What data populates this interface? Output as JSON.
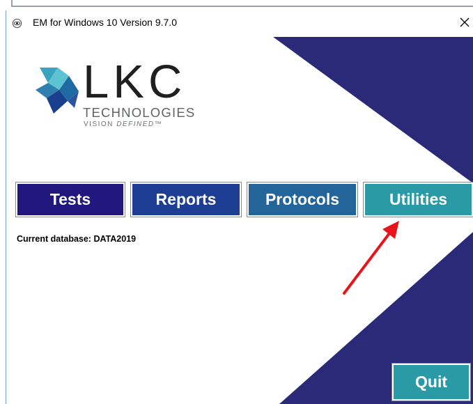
{
  "window": {
    "title": "EM for Windows 10 Version 9.7.0",
    "close_glyph": "✕"
  },
  "logo": {
    "main": "LKC",
    "sub": "TECHNOLOGIES",
    "tagline_prefix": "VISION ",
    "tagline_emphasis": "DEFINED",
    "tagline_mark": "™"
  },
  "nav": {
    "tests": "Tests",
    "reports": "Reports",
    "protocols": "Protocols",
    "utilities": "Utilities"
  },
  "status": {
    "current_database": "Current database: DATA2019"
  },
  "footer": {
    "quit": "Quit"
  },
  "icons": {
    "app": "eye-icon",
    "close": "close-icon",
    "annotation": "red-arrow-icon"
  },
  "colors": {
    "navy": "#2b2a78",
    "tests": "#21177f",
    "reports": "#1d3e92",
    "protocols": "#23659b",
    "utilities": "#2a9aa6",
    "quit": "#2a9aa6",
    "arrow": "#e8141b"
  }
}
